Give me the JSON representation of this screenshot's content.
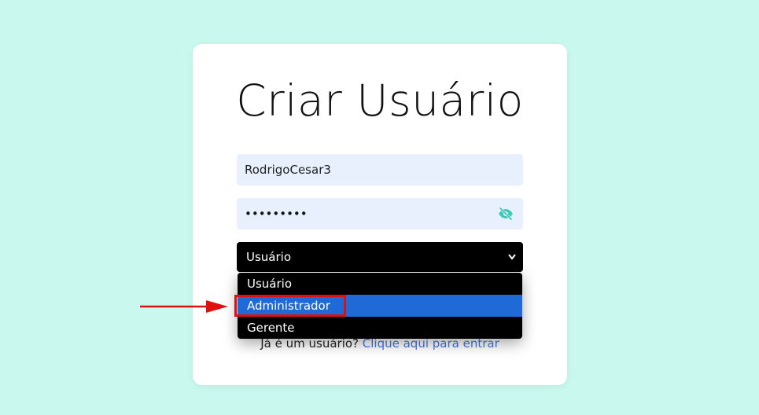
{
  "form": {
    "title": "Criar Usuário",
    "username_value": "RodrigoCesar3",
    "password_masked": "•••••••••",
    "password_toggle_icon": "eye-slash-icon",
    "role_select": {
      "selected": "Usuário",
      "options": [
        "Usuário",
        "Administrador",
        "Gerente"
      ],
      "highlighted_option": "Administrador"
    },
    "footer": {
      "text": "Já é um usuário?",
      "link": "Clique aqui para entrar"
    }
  },
  "annotation": {
    "arrow_color": "#e01010",
    "box_color": "#e01010"
  },
  "colors": {
    "background": "#c9f8ee",
    "card": "#ffffff",
    "input_bg": "#e8f0fe",
    "select_bg": "#000000",
    "highlight": "#1f6ad6",
    "link": "#4a78e0",
    "eye_icon": "#3cc9b5"
  }
}
